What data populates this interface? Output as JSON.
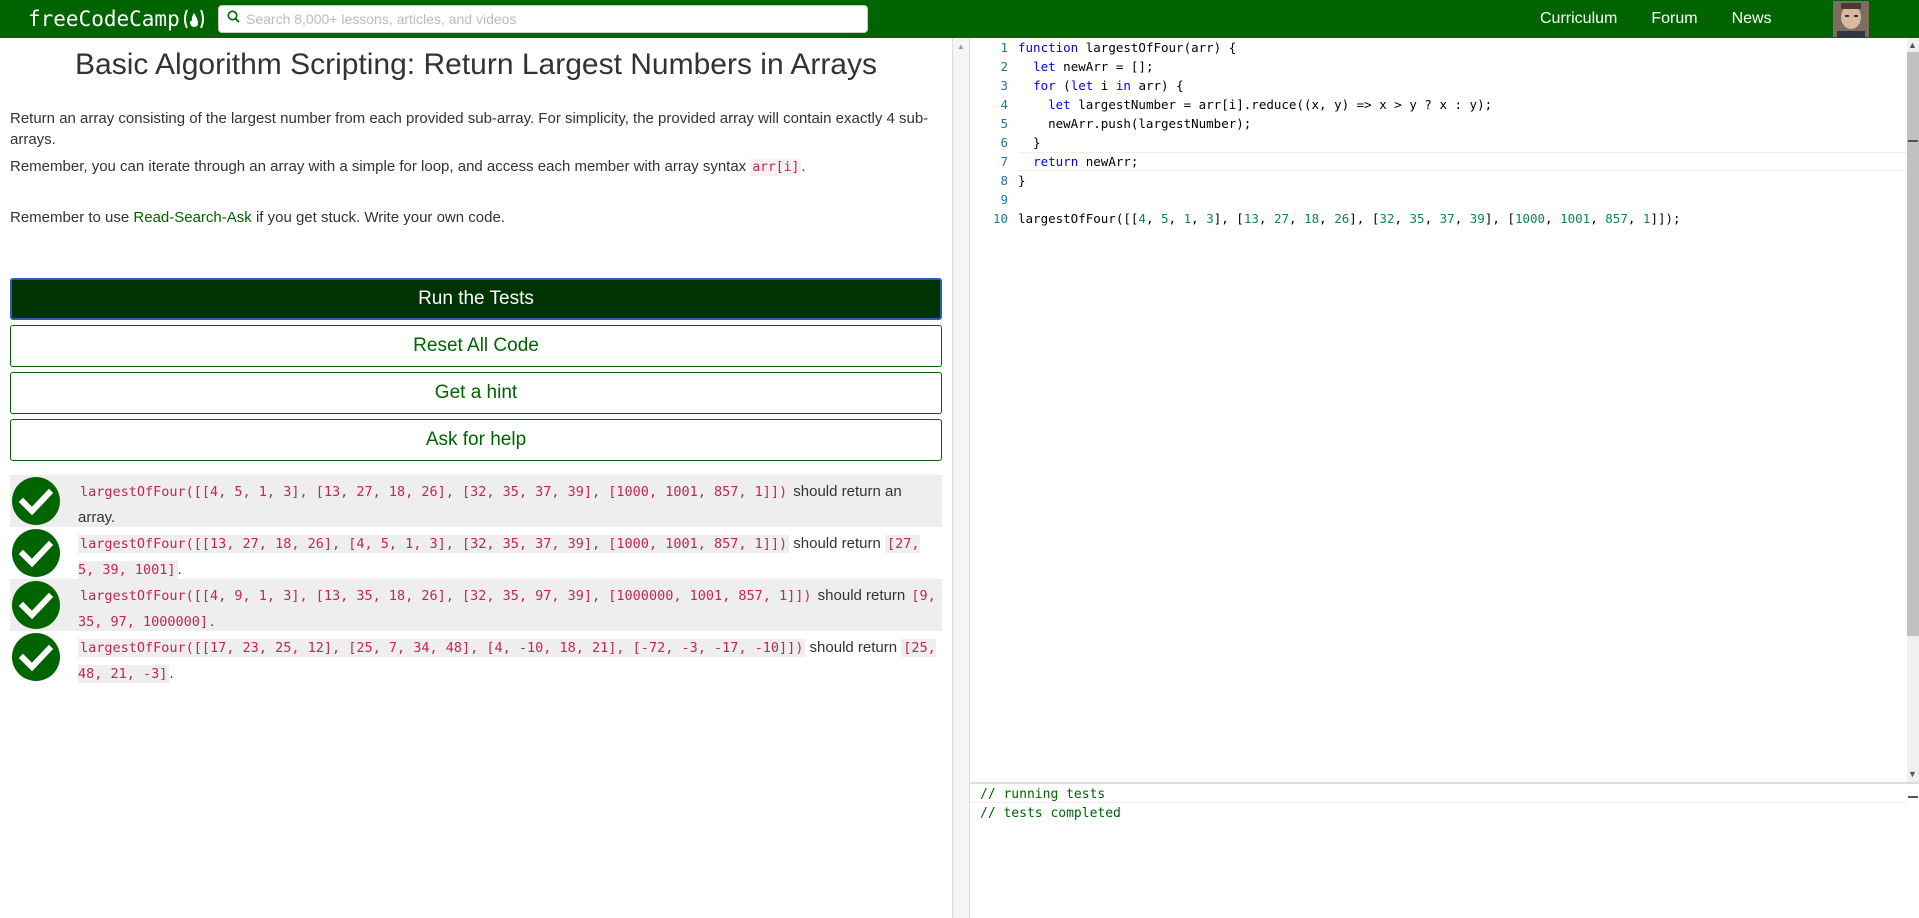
{
  "navbar": {
    "brand": "freeCodeCamp",
    "search_placeholder": "Search 8,000+ lessons, articles, and videos",
    "links": [
      "Curriculum",
      "Forum",
      "News"
    ]
  },
  "challenge": {
    "title": "Basic Algorithm Scripting: Return Largest Numbers in Arrays",
    "description": "Return an array consisting of the largest number from each provided sub-array. For simplicity, the provided array will contain exactly 4 sub-arrays.",
    "remember1_text": "Remember, you can iterate through an array with a simple for loop, and access each member with array syntax ",
    "remember1_code": "arr[i]",
    "remember1_end": ".",
    "remember2_prefix": "Remember to use ",
    "remember2_link": "Read-Search-Ask",
    "remember2_suffix": " if you get stuck. Write your own code."
  },
  "buttons": {
    "run": "Run the Tests",
    "reset": "Reset All Code",
    "hint": "Get a hint",
    "help": "Ask for help"
  },
  "tests": [
    {
      "code": "largestOfFour([[4, 5, 1, 3], [13, 27, 18, 26], [32, 35, 37, 39], [1000, 1001, 857, 1]])",
      "text": " should return an array.",
      "result": "",
      "end": ""
    },
    {
      "code": "largestOfFour([[13, 27, 18, 26], [4, 5, 1, 3], [32, 35, 37, 39], [1000, 1001, 857, 1]])",
      "text": " should return ",
      "result": "[27, 5, 39, 1001]",
      "end": "."
    },
    {
      "code": "largestOfFour([[4, 9, 1, 3], [13, 35, 18, 26], [32, 35, 97, 39], [1000000, 1001, 857, 1]])",
      "text": " should return ",
      "result": "[9, 35, 97, 1000000]",
      "end": "."
    },
    {
      "code": "largestOfFour([[17, 23, 25, 12], [25, 7, 34, 48], [4, -10, 18, 21], [-72, -3, -17, -10]])",
      "text": " should return ",
      "result": "[25, 48, 21, -3]",
      "end": "."
    }
  ],
  "editor": {
    "lines": [
      "function largestOfFour(arr) {",
      "  let newArr = [];",
      "  for (let i in arr) {",
      "    let largestNumber = arr[i].reduce((x, y) => x > y ? x : y);",
      "    newArr.push(largestNumber);",
      "  }",
      "  return newArr;",
      "}",
      "",
      "largestOfFour([[4, 5, 1, 3], [13, 27, 18, 26], [32, 35, 37, 39], [1000, 1001, 857, 1]]);"
    ]
  },
  "console": {
    "lines": [
      "// running tests",
      "// tests completed"
    ]
  },
  "colors": {
    "brand": "#006400",
    "run_button": "#003300",
    "code_inline": "#c7254e"
  }
}
